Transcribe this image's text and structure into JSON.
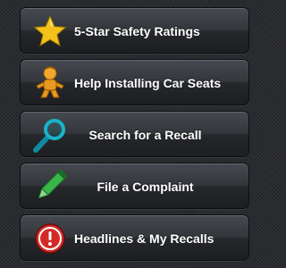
{
  "menu": {
    "items": [
      {
        "label": "5-Star Safety Ratings",
        "icon": "star-icon"
      },
      {
        "label": "Help Installing Car Seats",
        "icon": "baby-icon"
      },
      {
        "label": "Search for a Recall",
        "icon": "magnifier-icon"
      },
      {
        "label": "File a Complaint",
        "icon": "pencil-icon"
      },
      {
        "label": "Headlines & My Recalls",
        "icon": "alert-icon"
      }
    ]
  },
  "colors": {
    "star": "#f2c21a",
    "baby": "#e8a020",
    "magnifier": "#1ab3c8",
    "pencil": "#39b54a",
    "alert": "#d32a26"
  }
}
